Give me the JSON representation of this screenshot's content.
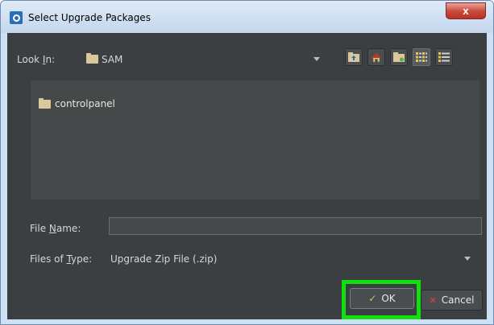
{
  "window": {
    "title": "Select Upgrade Packages",
    "close_label": "x"
  },
  "look_in": {
    "label_pre": "Look ",
    "label_mnemonic": "I",
    "label_post": "n:",
    "value": "SAM"
  },
  "toolbar": {
    "buttons": [
      "up-one-level",
      "home",
      "new-folder",
      "list-view",
      "details-view"
    ]
  },
  "file_list": {
    "items": [
      {
        "name": "controlpanel",
        "type": "folder"
      }
    ]
  },
  "file_name": {
    "label_pre": "File ",
    "label_mnemonic": "N",
    "label_post": "ame:",
    "value": "",
    "placeholder": ""
  },
  "file_type": {
    "label_pre": "Files of ",
    "label_mnemonic": "T",
    "label_post": "ype:",
    "selected": "Upgrade Zip File (.zip)"
  },
  "actions": {
    "ok_label": "OK",
    "cancel_label": "Cancel"
  },
  "colors": {
    "dialog_bg": "#3c3f41",
    "list_bg": "#45494a",
    "highlight": "#10e010",
    "cancel_x": "#e0403a",
    "ok_check": "#9fd86b"
  }
}
